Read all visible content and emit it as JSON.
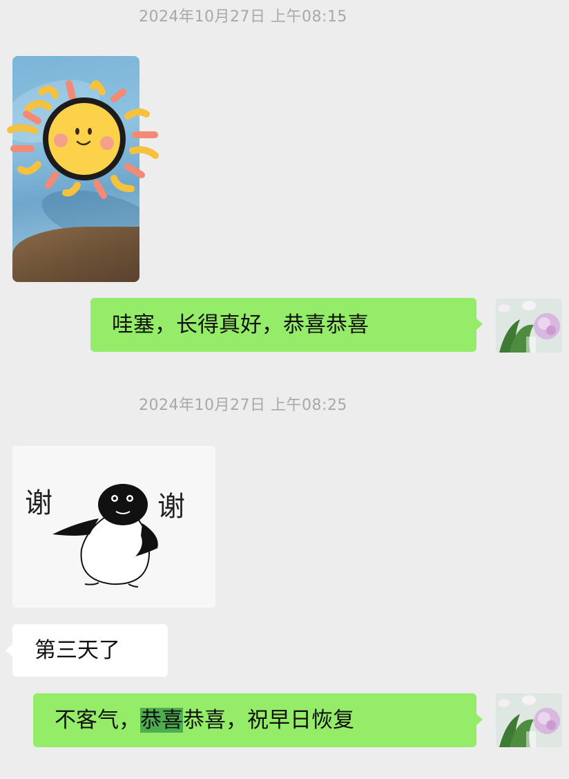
{
  "timestamps": [
    "2024年10月27日 上午08:15",
    "2024年10月27日 上午08:25"
  ],
  "messages": {
    "m1_sent": "哇塞，长得真好，恭喜恭喜",
    "m2_received": "第三天了",
    "m3_sent": {
      "before": "不客气，",
      "highlight": "恭喜",
      "after": "恭喜，祝早日恢复"
    }
  },
  "stickers": {
    "penguin": {
      "left_text": "谢",
      "right_text": "谢"
    }
  },
  "icons": {
    "sun_sticker": "sun-sticker-icon",
    "penguin_sticker": "penguin-sticker-icon",
    "avatar": "flower-avatar-icon"
  },
  "colors": {
    "bg": "#ededed",
    "sent_bubble": "#95ec69",
    "received_bubble": "#ffffff",
    "timestamp": "#a8a8a8"
  }
}
